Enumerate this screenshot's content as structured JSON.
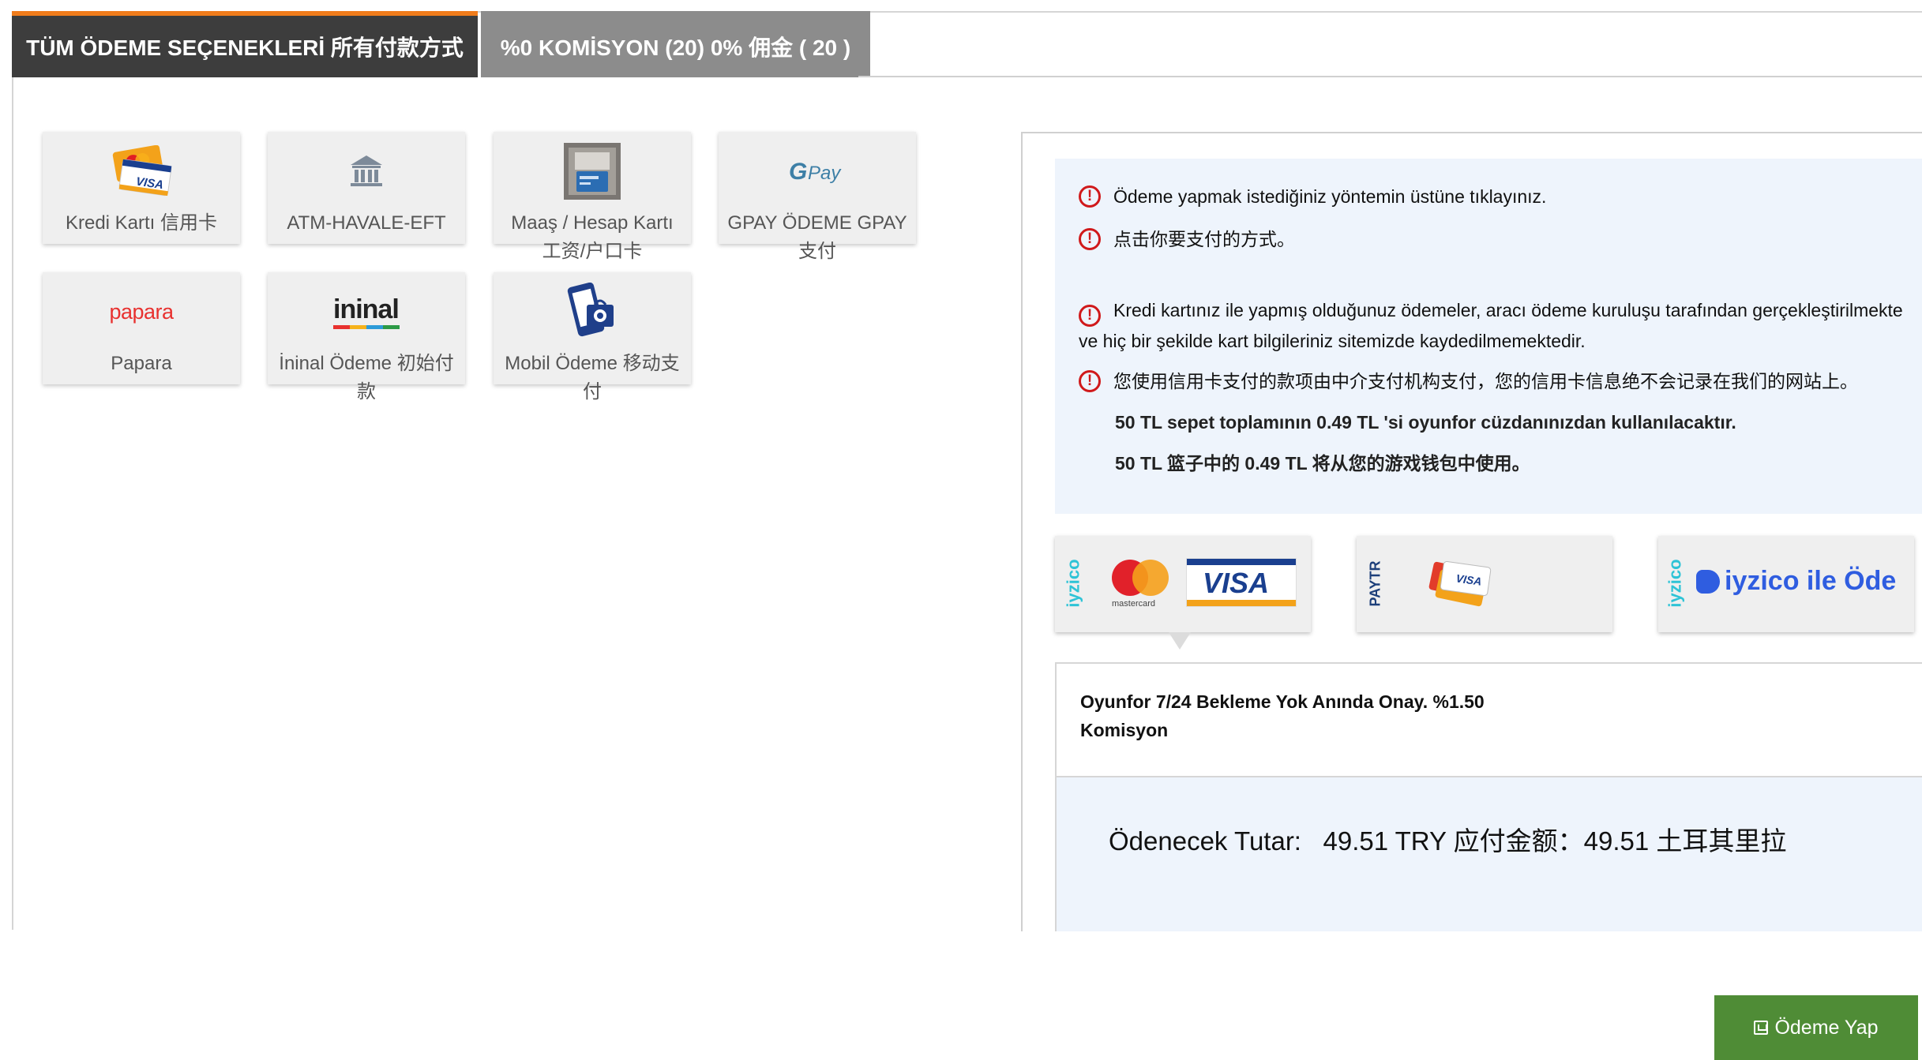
{
  "tabs": [
    {
      "label": "TÜM ÖDEME SEÇENEKLERİ 所有付款方式",
      "active": true
    },
    {
      "label": "%0 KOMİSYON (20) 0% 佣金 ( 20 )",
      "active": false
    }
  ],
  "methods": [
    {
      "label": "Kredi Kartı 信用卡",
      "icon": "credit-card-icon"
    },
    {
      "label": "ATM-HAVALE-EFT",
      "icon": "bank-icon"
    },
    {
      "label": "Maaş / Hesap Kartı 工资/户口卡",
      "icon": "atm-card-icon"
    },
    {
      "label": "GPAY ÖDEME GPAY支付",
      "icon": "gpay-icon"
    },
    {
      "label": "Papara",
      "icon": "papara-logo",
      "logo": "papara"
    },
    {
      "label": "İninal Ödeme 初始付款",
      "icon": "ininal-logo",
      "logo": "ininal"
    },
    {
      "label": "Mobil Ödeme 移动支付",
      "icon": "mobile-payment-icon"
    }
  ],
  "info": {
    "line1": "Ödeme yapmak istediğiniz yöntemin üstüne tıklayınız.",
    "line2": "点击你要支付的方式。",
    "line3": "Kredi kartınız ile yapmış olduğunuz ödemeler, aracı ödeme kuruluşu tarafından gerçekleştirilmekte ve hiç bir şekilde kart bilgileriniz sitemizde kaydedilmemektedir.",
    "line4": "您使用信用卡支付的款项由中介支付机构支付，您的信用卡信息绝不会记录在我们的网站上。",
    "wallet_tr": "50 TL sepet toplamının 0.49 TL 'si oyunfor cüzdanınızdan kullanılacaktır.",
    "wallet_zh": "50 TL 篮子中的 0.49 TL 将从您的游戏钱包中使用。"
  },
  "gateways": [
    {
      "brand": "iyzico",
      "cards": [
        "mastercard",
        "VISA"
      ],
      "selected": true
    },
    {
      "brand": "PAYTR",
      "cards": [
        "VISA"
      ],
      "selected": false
    },
    {
      "brand": "iyzico",
      "text": "iyzico ile Öde",
      "selected": false
    }
  ],
  "gateway_description": "Oyunfor 7/24 Bekleme Yok Anında Onay. %1.50 Komisyon",
  "amount": {
    "label": "Ödenecek Tutar:",
    "value": "49.51 TRY 应付金额：49.51 土耳其里拉"
  },
  "pay_button": "Ödeme Yap",
  "colors": {
    "accent": "#f07c1b",
    "tab_active": "#3d3d3d",
    "tab_inactive": "#8c8c8c",
    "info_bg": "#eef4fc",
    "warning": "#d0191b",
    "pay_button": "#4f8c36"
  }
}
